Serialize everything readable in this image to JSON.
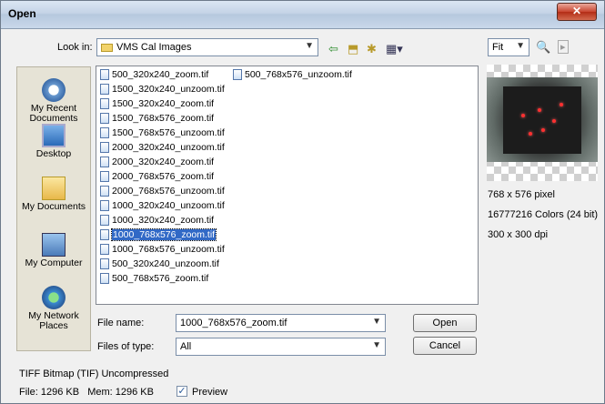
{
  "window": {
    "title": "Open",
    "close_glyph": "✕"
  },
  "lookin": {
    "label": "Look in:",
    "value": "VMS Cal Images"
  },
  "toolbar": {
    "back_icon": "arrow-left",
    "up_icon": "folder-up",
    "new_folder_icon": "new-folder",
    "views_icon": "views-menu"
  },
  "places": [
    {
      "label": "My Recent Documents",
      "icon": "recent-documents"
    },
    {
      "label": "Desktop",
      "icon": "desktop"
    },
    {
      "label": "My Documents",
      "icon": "my-documents"
    },
    {
      "label": "My Computer",
      "icon": "my-computer"
    },
    {
      "label": "My Network Places",
      "icon": "network-places"
    }
  ],
  "files": [
    "500_320x240_zoom.tif",
    "1500_320x240_unzoom.tif",
    "1500_320x240_zoom.tif",
    "1500_768x576_zoom.tif",
    "1500_768x576_unzoom.tif",
    "2000_320x240_unzoom.tif",
    "2000_320x240_zoom.tif",
    "2000_768x576_zoom.tif",
    "2000_768x576_unzoom.tif",
    "1000_320x240_unzoom.tif",
    "1000_320x240_zoom.tif",
    "1000_768x576_zoom.tif",
    "1000_768x576_unzoom.tif",
    "500_320x240_unzoom.tif",
    "500_768x576_zoom.tif",
    "500_768x576_unzoom.tif"
  ],
  "selected_file": "1000_768x576_zoom.tif",
  "filename": {
    "label": "File name:",
    "value": "1000_768x576_zoom.tif"
  },
  "filetype": {
    "label": "Files of type:",
    "value": "All"
  },
  "buttons": {
    "open": "Open",
    "cancel": "Cancel"
  },
  "zoom": {
    "value": "Fit"
  },
  "preview_info": {
    "dimensions": "768 x 576 pixel",
    "colors": "16777216 Colors (24 bit)",
    "dpi": "300 x 300 dpi"
  },
  "status": {
    "format": "TIFF Bitmap (TIF) Uncompressed",
    "size": "File: 1296 KB   Mem: 1296 KB",
    "preview_label": "Preview",
    "preview_checked": true
  }
}
